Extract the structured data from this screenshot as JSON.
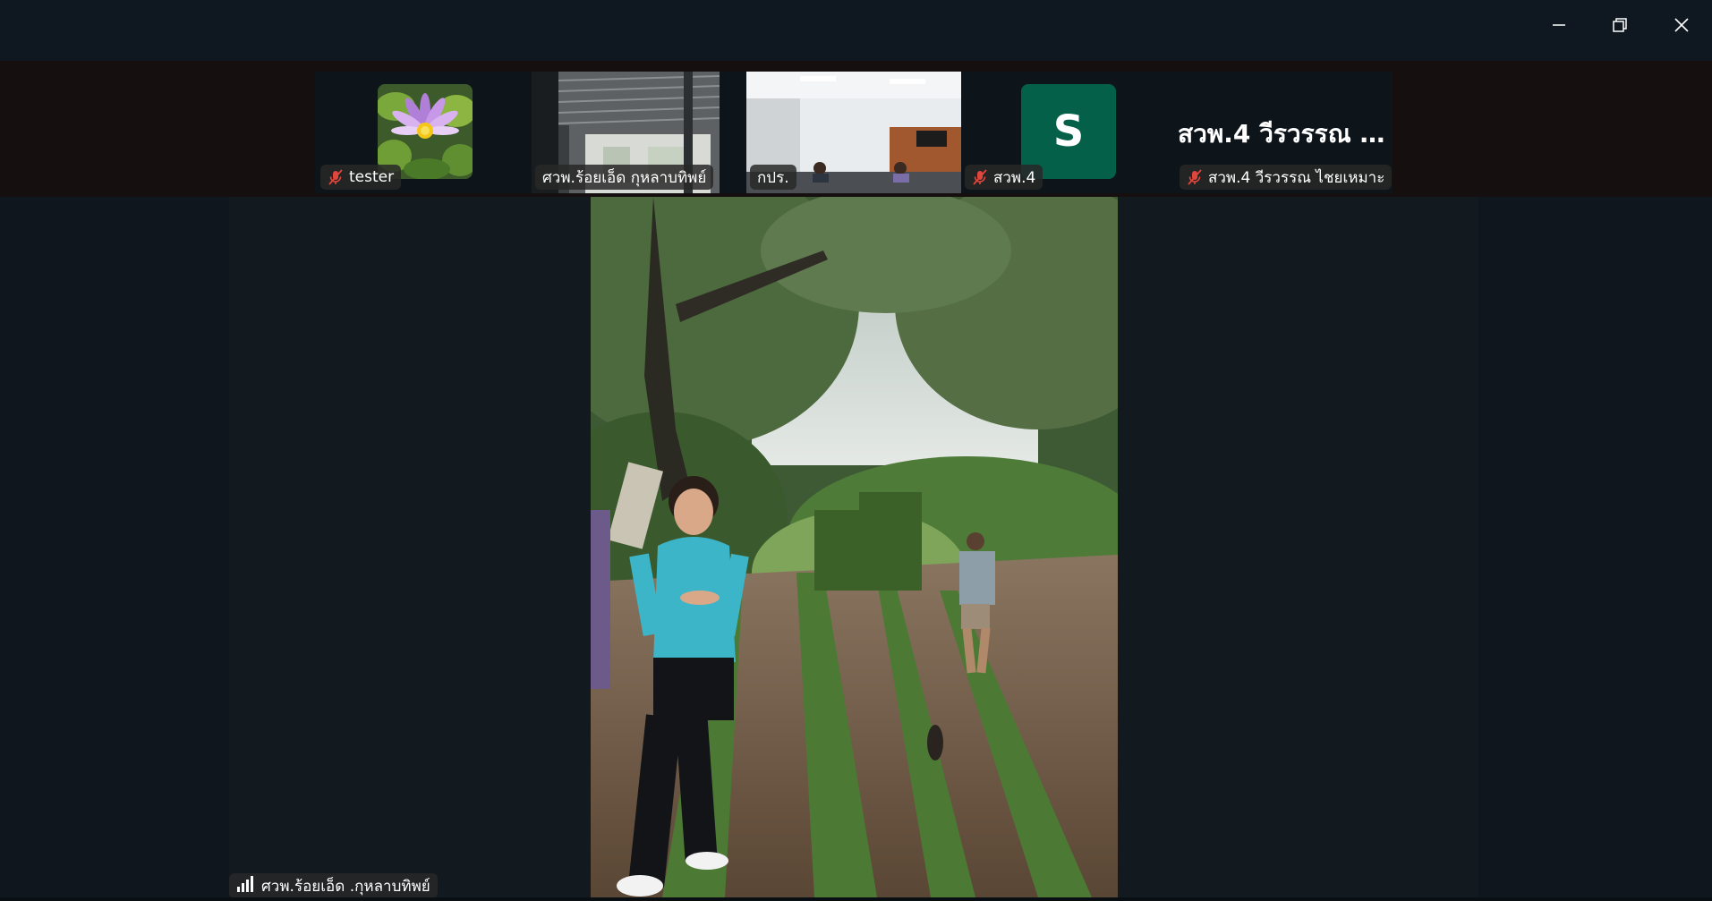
{
  "window": {
    "controls": [
      "minimize",
      "restore",
      "close"
    ]
  },
  "participants": [
    {
      "name": "tester",
      "muted": true,
      "tile_type": "image",
      "icon": "lotus-flower-image"
    },
    {
      "name": "ศวพ.ร้อยเอ็ด กุหลาบทิพย์",
      "muted": false,
      "tile_type": "video"
    },
    {
      "name": "กปร.",
      "muted": false,
      "tile_type": "video"
    },
    {
      "name": "สวพ.4",
      "muted": true,
      "tile_type": "letter",
      "letter": "S",
      "color": "#046049"
    },
    {
      "name": "สวพ.4 วีรวรรณ ไชยเหมาะ",
      "muted": true,
      "tile_type": "text",
      "display_title": "สวพ.4 วีรวรรณ ไ..."
    }
  ],
  "main_speaker": {
    "name": "ศวพ.ร้อยเอ็ด .กุหลาบทิพย์",
    "icon": "signal-strength-icon"
  },
  "colors": {
    "background": "#0f161d",
    "strip": "#150f0f",
    "mute_red": "#e0463c",
    "avatar_green": "#046049"
  }
}
